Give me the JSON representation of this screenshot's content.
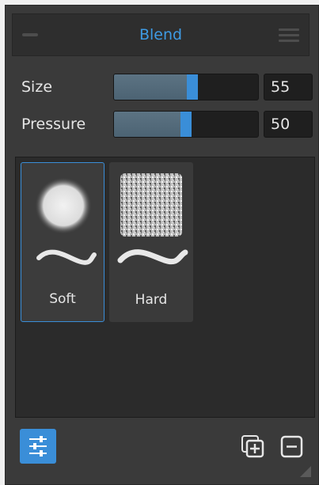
{
  "panel": {
    "title": "Blend"
  },
  "controls": {
    "size": {
      "label": "Size",
      "value": "55",
      "level_percent": 55
    },
    "pressure": {
      "label": "Pressure",
      "value": "50",
      "level_percent": 50
    }
  },
  "brushes": [
    {
      "name": "Soft",
      "selected": true
    },
    {
      "name": "Hard",
      "selected": false
    }
  ],
  "colors": {
    "accent": "#3a8ed8",
    "title": "#3e9be4"
  },
  "icons": {
    "settings": "sliders-icon",
    "duplicate": "duplicate-brush-icon",
    "remove": "remove-brush-icon",
    "resize": "resize-grip-icon"
  }
}
